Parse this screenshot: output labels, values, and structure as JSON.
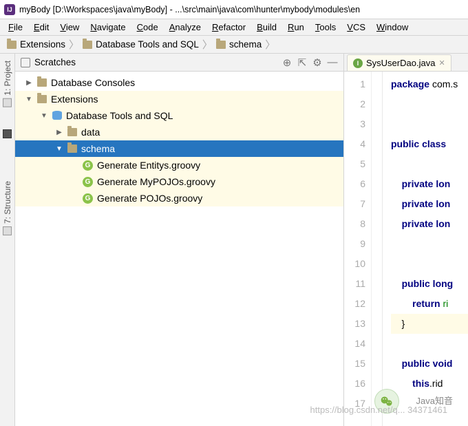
{
  "title": "myBody [D:\\Workspaces\\java\\myBody] - ...\\src\\main\\java\\com\\hunter\\mybody\\modules\\en",
  "app_icon": "IJ",
  "menu": [
    "File",
    "Edit",
    "View",
    "Navigate",
    "Code",
    "Analyze",
    "Refactor",
    "Build",
    "Run",
    "Tools",
    "VCS",
    "Window"
  ],
  "menu_mnemonics": [
    "F",
    "E",
    "V",
    "N",
    "C",
    "A",
    "R",
    "B",
    "R",
    "T",
    "V",
    "W"
  ],
  "breadcrumbs": [
    "Extensions",
    "Database Tools and SQL",
    "schema"
  ],
  "left_tools": [
    {
      "label": "1: Project"
    },
    {
      "label": "7: Structure"
    }
  ],
  "panel": {
    "title": "Scratches",
    "toolbar_icons": [
      "target-icon",
      "collapse-icon",
      "gear-icon",
      "hide-icon"
    ]
  },
  "tree": [
    {
      "depth": 0,
      "arrow": "▶",
      "icon": "folder",
      "label": "Database Consoles",
      "hl": false,
      "sel": false
    },
    {
      "depth": 0,
      "arrow": "▼",
      "icon": "folder",
      "label": "Extensions",
      "hl": true,
      "sel": false
    },
    {
      "depth": 1,
      "arrow": "▼",
      "icon": "db",
      "label": "Database Tools and SQL",
      "hl": true,
      "sel": false
    },
    {
      "depth": 2,
      "arrow": "▶",
      "icon": "folder",
      "label": "data",
      "hl": true,
      "sel": false
    },
    {
      "depth": 2,
      "arrow": "▼",
      "icon": "folder",
      "label": "schema",
      "hl": false,
      "sel": true
    },
    {
      "depth": 3,
      "arrow": "",
      "icon": "g",
      "label": "Generate Entitys.groovy",
      "hl": true,
      "sel": false
    },
    {
      "depth": 3,
      "arrow": "",
      "icon": "g",
      "label": "Generate MyPOJOs.groovy",
      "hl": true,
      "sel": false
    },
    {
      "depth": 3,
      "arrow": "",
      "icon": "g",
      "label": "Generate POJOs.groovy",
      "hl": true,
      "sel": false
    }
  ],
  "editor": {
    "tab": {
      "icon": "I",
      "name": "SysUserDao.java"
    },
    "lines": [
      {
        "n": 1,
        "tokens": [
          {
            "t": "package ",
            "c": "kw"
          },
          {
            "t": "com.s",
            "c": "pkg"
          }
        ],
        "hl": false
      },
      {
        "n": 2,
        "tokens": [],
        "hl": false
      },
      {
        "n": 3,
        "tokens": [],
        "hl": false
      },
      {
        "n": 4,
        "tokens": [
          {
            "t": "public class ",
            "c": "kw"
          }
        ],
        "hl": false
      },
      {
        "n": 5,
        "tokens": [],
        "hl": false
      },
      {
        "n": 6,
        "tokens": [
          {
            "t": "    ",
            "c": ""
          },
          {
            "t": "private lon",
            "c": "kw"
          }
        ],
        "hl": false
      },
      {
        "n": 7,
        "tokens": [
          {
            "t": "    ",
            "c": ""
          },
          {
            "t": "private lon",
            "c": "kw"
          }
        ],
        "hl": false
      },
      {
        "n": 8,
        "tokens": [
          {
            "t": "    ",
            "c": ""
          },
          {
            "t": "private lon",
            "c": "kw"
          }
        ],
        "hl": false
      },
      {
        "n": 9,
        "tokens": [],
        "hl": false
      },
      {
        "n": 10,
        "tokens": [],
        "hl": false
      },
      {
        "n": 11,
        "tokens": [
          {
            "t": "    ",
            "c": ""
          },
          {
            "t": "public long",
            "c": "kw"
          }
        ],
        "hl": false
      },
      {
        "n": 12,
        "tokens": [
          {
            "t": "        ",
            "c": ""
          },
          {
            "t": "return ",
            "c": "kw"
          },
          {
            "t": "ri",
            "c": "err"
          }
        ],
        "hl": false
      },
      {
        "n": 13,
        "tokens": [
          {
            "t": "    }",
            "c": ""
          }
        ],
        "hl": true
      },
      {
        "n": 14,
        "tokens": [],
        "hl": false
      },
      {
        "n": 15,
        "tokens": [
          {
            "t": "    ",
            "c": ""
          },
          {
            "t": "public void",
            "c": "kw"
          }
        ],
        "hl": false
      },
      {
        "n": 16,
        "tokens": [
          {
            "t": "        ",
            "c": ""
          },
          {
            "t": "this",
            "c": "kw"
          },
          {
            "t": ".rid ",
            "c": ""
          }
        ],
        "hl": false
      },
      {
        "n": 17,
        "tokens": [],
        "hl": false
      }
    ]
  },
  "watermark": "https://blog.csdn.net/q... 34371461",
  "overlay_label": "Java知音"
}
